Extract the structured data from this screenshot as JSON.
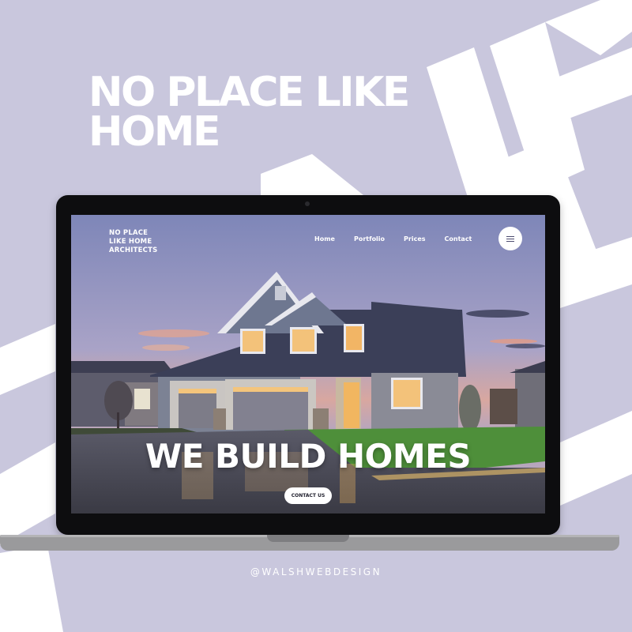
{
  "poster": {
    "headline_line1": "NO PLACE LIKE",
    "headline_line2": "HOME",
    "credit": "@WALSHWEBDESIGN"
  },
  "website": {
    "brand_line1": "NO PLACE",
    "brand_line2": "LIKE HOME",
    "brand_line3": "ARCHITECTS",
    "nav": [
      {
        "label": "Home"
      },
      {
        "label": "Portfolio"
      },
      {
        "label": "Prices"
      },
      {
        "label": "Contact"
      }
    ],
    "menu_icon": "hamburger-menu-icon",
    "hero_title": "WE BUILD HOMES",
    "cta_label": "CONTACT US"
  },
  "colors": {
    "background": "#c9c7dd",
    "decorative_letters": "#ffffff",
    "laptop_bezel": "#0d0d0f",
    "laptop_base": "#9a9a9c"
  }
}
